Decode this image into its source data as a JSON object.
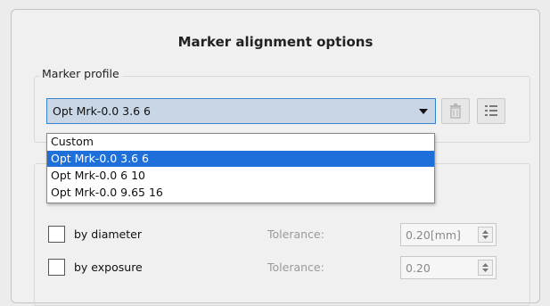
{
  "dialog": {
    "title": "Marker alignment options"
  },
  "marker_profile": {
    "group_label": "Marker profile",
    "selected_value": "Opt Mrk-0.0 3.6 6",
    "delete_icon": "trash-icon",
    "list_icon": "list-icon",
    "options": [
      {
        "label": "Custom",
        "selected": false
      },
      {
        "label": "Opt Mrk-0.0 3.6 6",
        "selected": true
      },
      {
        "label": "Opt Mrk-0.0 6 10",
        "selected": false
      },
      {
        "label": "Opt Mrk-0.0 9.65 16",
        "selected": false
      }
    ]
  },
  "alignment": {
    "rows": [
      {
        "check_label": "by diameter",
        "checked": false,
        "tolerance_label": "Tolerance:",
        "tolerance_value": "0.20[mm]"
      },
      {
        "check_label": "by exposure",
        "checked": false,
        "tolerance_label": "Tolerance:",
        "tolerance_value": "0.20"
      }
    ]
  },
  "colors": {
    "accent": "#1e6fd9",
    "combo_bg": "#c8d6e5",
    "combo_border": "#3a82cc"
  }
}
